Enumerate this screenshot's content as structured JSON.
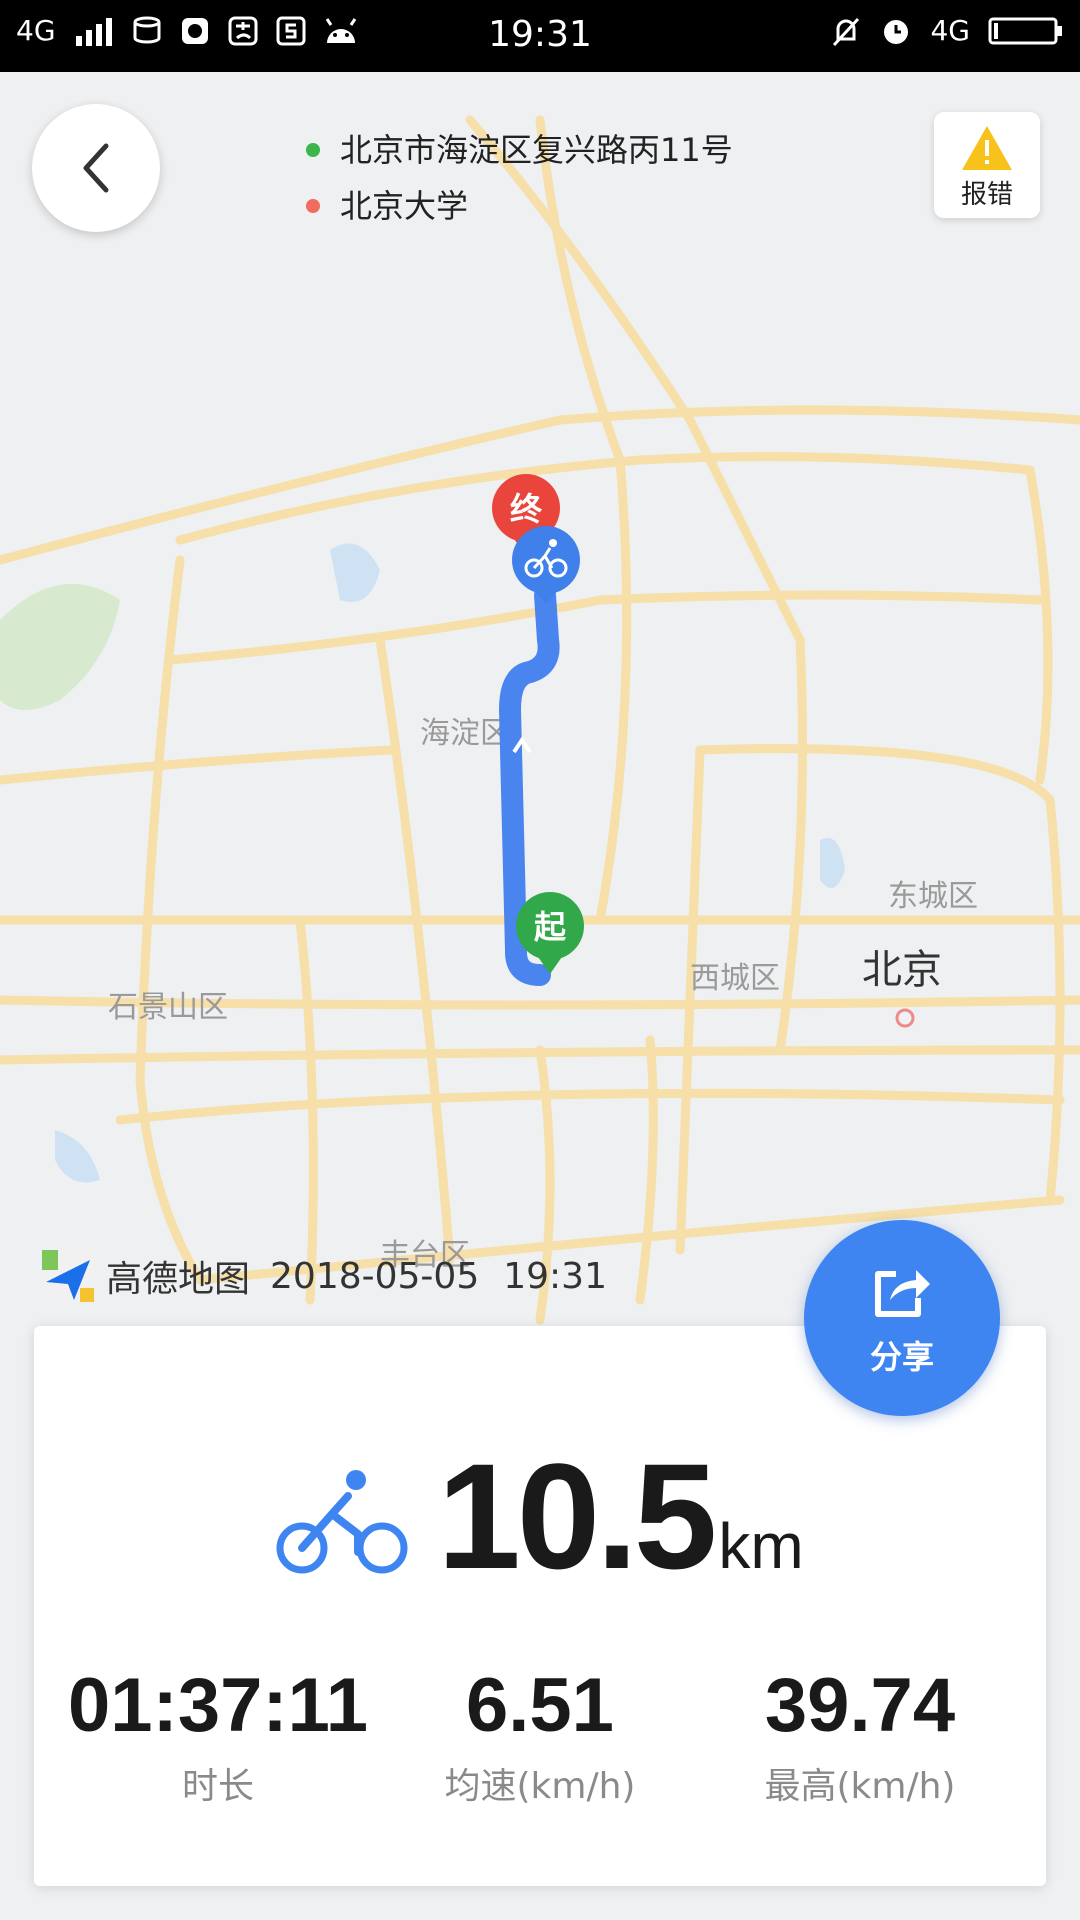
{
  "status_bar": {
    "left": "4G",
    "time": "19:31",
    "right": "4G"
  },
  "header": {
    "start_address": "北京市海淀区复兴路丙11号",
    "end_address": "北京大学",
    "report_label": "报错",
    "start_dot_color": "#3cb54a",
    "end_dot_color": "#f26b5f"
  },
  "map": {
    "labels": {
      "haidian": "海淀区",
      "dongcheng": "东城区",
      "xicheng": "西城区",
      "beijing": "北京",
      "shijingshan": "石景山区",
      "fengtai": "丰台区"
    },
    "start_marker": "起",
    "end_marker": "终",
    "route_color": "#4a84ef"
  },
  "watermark": {
    "brand": "高德地图",
    "date": "2018-05-05",
    "time": "19:31"
  },
  "share": {
    "label": "分享"
  },
  "summary": {
    "distance": "10.5",
    "distance_unit": "km",
    "stats": [
      {
        "value": "01:37:11",
        "label": "时长"
      },
      {
        "value": "6.51",
        "label": "均速(km/h)"
      },
      {
        "value": "39.74",
        "label": "最高(km/h)"
      }
    ]
  }
}
